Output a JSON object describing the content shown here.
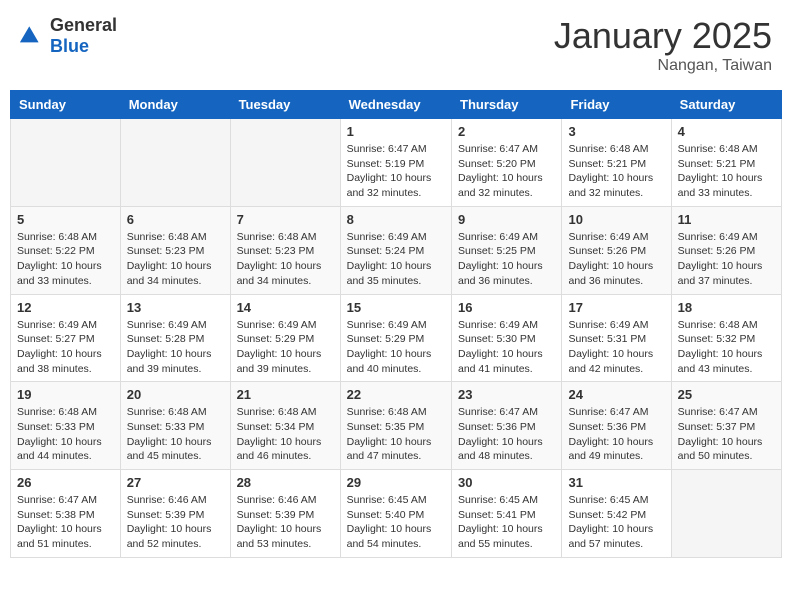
{
  "logo": {
    "general": "General",
    "blue": "Blue"
  },
  "header": {
    "month": "January 2025",
    "location": "Nangan, Taiwan"
  },
  "weekdays": [
    "Sunday",
    "Monday",
    "Tuesday",
    "Wednesday",
    "Thursday",
    "Friday",
    "Saturday"
  ],
  "weeks": [
    [
      {
        "day": "",
        "info": ""
      },
      {
        "day": "",
        "info": ""
      },
      {
        "day": "",
        "info": ""
      },
      {
        "day": "1",
        "info": "Sunrise: 6:47 AM\nSunset: 5:19 PM\nDaylight: 10 hours\nand 32 minutes."
      },
      {
        "day": "2",
        "info": "Sunrise: 6:47 AM\nSunset: 5:20 PM\nDaylight: 10 hours\nand 32 minutes."
      },
      {
        "day": "3",
        "info": "Sunrise: 6:48 AM\nSunset: 5:21 PM\nDaylight: 10 hours\nand 32 minutes."
      },
      {
        "day": "4",
        "info": "Sunrise: 6:48 AM\nSunset: 5:21 PM\nDaylight: 10 hours\nand 33 minutes."
      }
    ],
    [
      {
        "day": "5",
        "info": "Sunrise: 6:48 AM\nSunset: 5:22 PM\nDaylight: 10 hours\nand 33 minutes."
      },
      {
        "day": "6",
        "info": "Sunrise: 6:48 AM\nSunset: 5:23 PM\nDaylight: 10 hours\nand 34 minutes."
      },
      {
        "day": "7",
        "info": "Sunrise: 6:48 AM\nSunset: 5:23 PM\nDaylight: 10 hours\nand 34 minutes."
      },
      {
        "day": "8",
        "info": "Sunrise: 6:49 AM\nSunset: 5:24 PM\nDaylight: 10 hours\nand 35 minutes."
      },
      {
        "day": "9",
        "info": "Sunrise: 6:49 AM\nSunset: 5:25 PM\nDaylight: 10 hours\nand 36 minutes."
      },
      {
        "day": "10",
        "info": "Sunrise: 6:49 AM\nSunset: 5:26 PM\nDaylight: 10 hours\nand 36 minutes."
      },
      {
        "day": "11",
        "info": "Sunrise: 6:49 AM\nSunset: 5:26 PM\nDaylight: 10 hours\nand 37 minutes."
      }
    ],
    [
      {
        "day": "12",
        "info": "Sunrise: 6:49 AM\nSunset: 5:27 PM\nDaylight: 10 hours\nand 38 minutes."
      },
      {
        "day": "13",
        "info": "Sunrise: 6:49 AM\nSunset: 5:28 PM\nDaylight: 10 hours\nand 39 minutes."
      },
      {
        "day": "14",
        "info": "Sunrise: 6:49 AM\nSunset: 5:29 PM\nDaylight: 10 hours\nand 39 minutes."
      },
      {
        "day": "15",
        "info": "Sunrise: 6:49 AM\nSunset: 5:29 PM\nDaylight: 10 hours\nand 40 minutes."
      },
      {
        "day": "16",
        "info": "Sunrise: 6:49 AM\nSunset: 5:30 PM\nDaylight: 10 hours\nand 41 minutes."
      },
      {
        "day": "17",
        "info": "Sunrise: 6:49 AM\nSunset: 5:31 PM\nDaylight: 10 hours\nand 42 minutes."
      },
      {
        "day": "18",
        "info": "Sunrise: 6:48 AM\nSunset: 5:32 PM\nDaylight: 10 hours\nand 43 minutes."
      }
    ],
    [
      {
        "day": "19",
        "info": "Sunrise: 6:48 AM\nSunset: 5:33 PM\nDaylight: 10 hours\nand 44 minutes."
      },
      {
        "day": "20",
        "info": "Sunrise: 6:48 AM\nSunset: 5:33 PM\nDaylight: 10 hours\nand 45 minutes."
      },
      {
        "day": "21",
        "info": "Sunrise: 6:48 AM\nSunset: 5:34 PM\nDaylight: 10 hours\nand 46 minutes."
      },
      {
        "day": "22",
        "info": "Sunrise: 6:48 AM\nSunset: 5:35 PM\nDaylight: 10 hours\nand 47 minutes."
      },
      {
        "day": "23",
        "info": "Sunrise: 6:47 AM\nSunset: 5:36 PM\nDaylight: 10 hours\nand 48 minutes."
      },
      {
        "day": "24",
        "info": "Sunrise: 6:47 AM\nSunset: 5:36 PM\nDaylight: 10 hours\nand 49 minutes."
      },
      {
        "day": "25",
        "info": "Sunrise: 6:47 AM\nSunset: 5:37 PM\nDaylight: 10 hours\nand 50 minutes."
      }
    ],
    [
      {
        "day": "26",
        "info": "Sunrise: 6:47 AM\nSunset: 5:38 PM\nDaylight: 10 hours\nand 51 minutes."
      },
      {
        "day": "27",
        "info": "Sunrise: 6:46 AM\nSunset: 5:39 PM\nDaylight: 10 hours\nand 52 minutes."
      },
      {
        "day": "28",
        "info": "Sunrise: 6:46 AM\nSunset: 5:39 PM\nDaylight: 10 hours\nand 53 minutes."
      },
      {
        "day": "29",
        "info": "Sunrise: 6:45 AM\nSunset: 5:40 PM\nDaylight: 10 hours\nand 54 minutes."
      },
      {
        "day": "30",
        "info": "Sunrise: 6:45 AM\nSunset: 5:41 PM\nDaylight: 10 hours\nand 55 minutes."
      },
      {
        "day": "31",
        "info": "Sunrise: 6:45 AM\nSunset: 5:42 PM\nDaylight: 10 hours\nand 57 minutes."
      },
      {
        "day": "",
        "info": ""
      }
    ]
  ]
}
